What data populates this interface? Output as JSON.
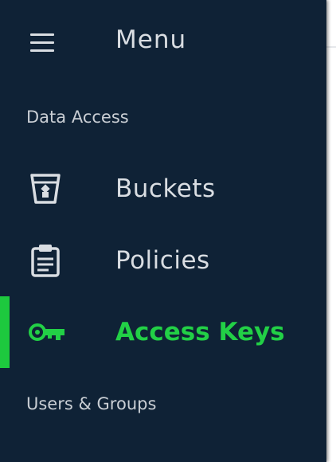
{
  "sidebar": {
    "menu_title": "Menu",
    "sections": {
      "data_access": "Data Access",
      "users_groups": "Users & Groups"
    },
    "items": [
      {
        "label": "Buckets",
        "icon": "bucket-icon",
        "active": false
      },
      {
        "label": "Policies",
        "icon": "clipboard-icon",
        "active": false
      },
      {
        "label": "Access Keys",
        "icon": "key-icon",
        "active": true
      }
    ]
  },
  "colors": {
    "sidebar_bg": "#0f2236",
    "text": "#d9dde2",
    "accent": "#22d046"
  }
}
